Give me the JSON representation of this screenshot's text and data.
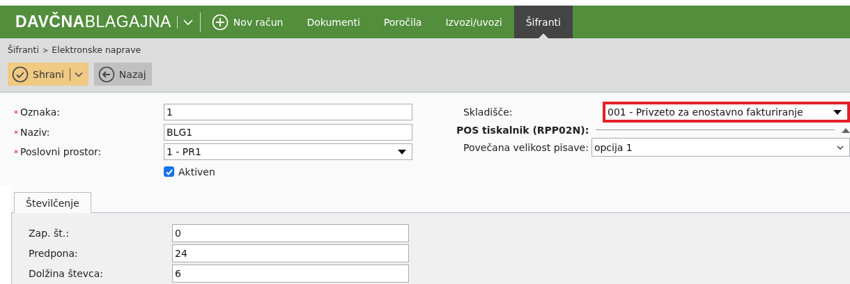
{
  "app": {
    "logo_bold": "DAVČNA",
    "logo_light": "BLAGAJNA"
  },
  "nav": [
    {
      "label": "Nov račun",
      "kind": "action",
      "selected": false
    },
    {
      "label": "Dokumenti",
      "kind": "link",
      "selected": false
    },
    {
      "label": "Poročila",
      "kind": "link",
      "selected": false
    },
    {
      "label": "Izvozi/uvozi",
      "kind": "link",
      "selected": false
    },
    {
      "label": "Šifranti",
      "kind": "link",
      "selected": true
    }
  ],
  "breadcrumb": [
    {
      "label": "Šifranti"
    },
    {
      "label": "Elektronske naprave"
    }
  ],
  "separator": ">",
  "required_mark": "*",
  "toolbar": [
    {
      "label": "Shrani",
      "kind": "save"
    },
    {
      "label": "Nazaj",
      "kind": "back"
    }
  ],
  "left_fields": [
    {
      "label": "Oznaka:",
      "required": true,
      "kind": "text",
      "value": "1"
    },
    {
      "label": "Naziv:",
      "required": true,
      "kind": "text",
      "value": "BLG1"
    },
    {
      "label": "Poslovni prostor:",
      "required": true,
      "kind": "select",
      "value": "1 - PR1"
    }
  ],
  "checkbox": {
    "label": "Aktiven",
    "checked": true
  },
  "right_field": {
    "label": "Skladišče:",
    "kind": "select",
    "value": "001 - Privzeto za enostavno fakturiranje",
    "highlighted": true
  },
  "section": {
    "title": "POS tiskalnik (RPP02N):",
    "expanded": true,
    "fields": [
      {
        "label": "Povečana velikost pisave:",
        "kind": "dropdown",
        "value": "opcija 1"
      }
    ]
  },
  "tabs": [
    {
      "label": "Številčenje",
      "selected": true
    }
  ],
  "tab_fields": [
    {
      "label": "Zap. št.:",
      "value": "0"
    },
    {
      "label": "Predpona:",
      "value": "24"
    },
    {
      "label": "Dolžina števca:",
      "value": "6"
    }
  ]
}
